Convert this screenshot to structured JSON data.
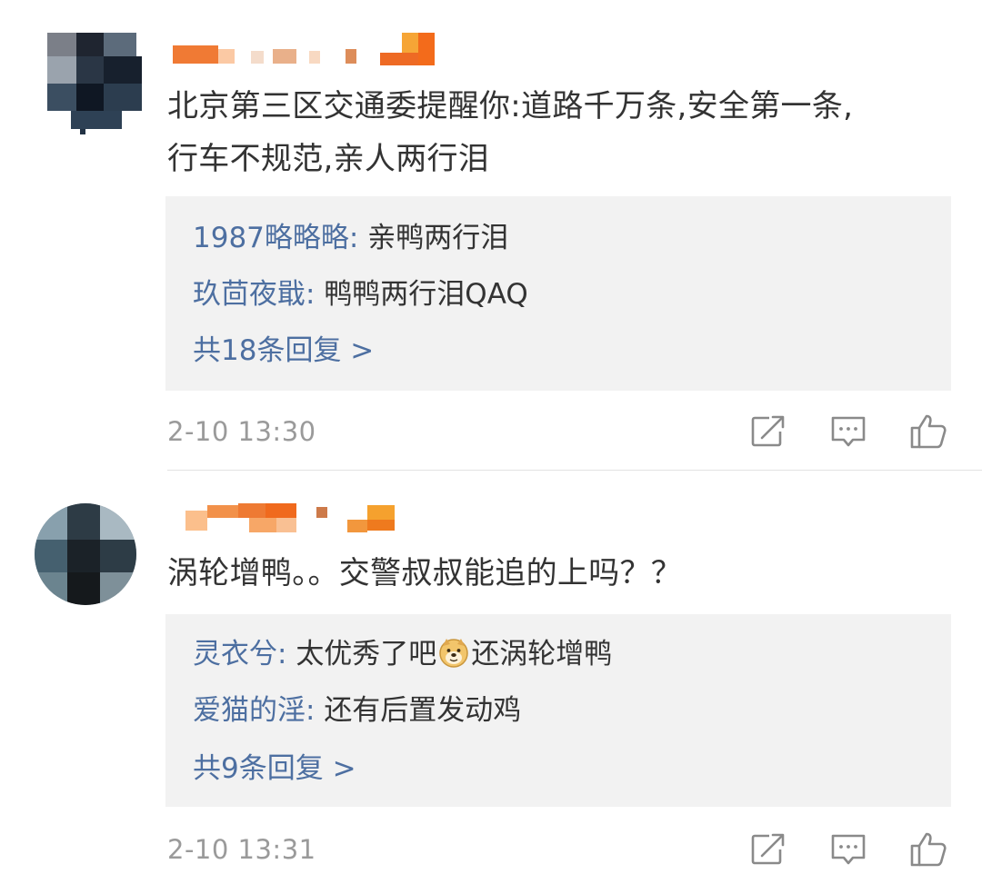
{
  "comments": [
    {
      "text_line1": "北京第三区交通委提醒你:道路千万条,安全第一条,",
      "text_line2": "行车不规范,亲人两行泪",
      "replies": [
        {
          "author": "1987略略略",
          "sep": ": ",
          "body": "亲鸭两行泪"
        },
        {
          "author": "玖茴夜戢",
          "sep": ": ",
          "body": "鸭鸭两行泪QAQ"
        }
      ],
      "reply_count": "共18条回复 >",
      "timestamp": "2-10 13:30"
    },
    {
      "text_line1": "涡轮增鸭。。交警叔叔能追的上吗？？",
      "replies": [
        {
          "author": "灵衣兮",
          "sep": ": ",
          "body_before": "太优秀了吧",
          "emoji": "doge-emoji",
          "body_after": "还涡轮增鸭"
        },
        {
          "author": "爱猫的淫",
          "sep": ": ",
          "body": "还有后置发动鸡"
        }
      ],
      "reply_count": "共9条回复 >",
      "timestamp": "2-10 13:31"
    }
  ],
  "icons": {
    "repost": "repost-icon",
    "comment": "comment-icon",
    "like": "like-icon"
  },
  "colors": {
    "link": "#4d6fa1",
    "text": "#333333",
    "meta": "#9a9a9a",
    "reply_bg": "#f2f2f2"
  }
}
